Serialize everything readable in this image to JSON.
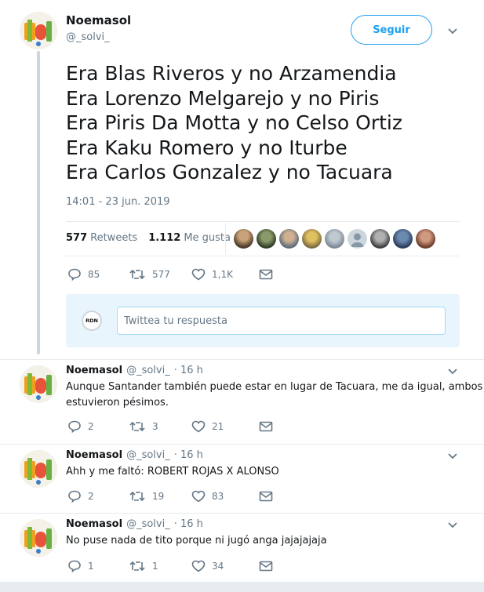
{
  "main_tweet": {
    "author_name": "Noemasol",
    "author_handle": "@_solvi_",
    "follow_label": "Seguir",
    "lines": [
      "Era Blas Riveros y no Arzamendia",
      "Era Lorenzo Melgarejo y no Piris",
      "Era Piris Da Motta y no Celso Ortiz",
      "Era Kaku Romero y no Iturbe",
      "Era Carlos Gonzalez y no Tacuara"
    ],
    "timestamp": "14:01 - 23 jun. 2019",
    "retweets_count": "577",
    "retweets_label": "Retweets",
    "likes_count": "1.112",
    "likes_label": "Me gusta",
    "actions": {
      "replies": "85",
      "retweets": "577",
      "likes": "1,1K"
    }
  },
  "reply_box": {
    "avatar_label": "RDN",
    "placeholder": "Twittea tu respuesta"
  },
  "replies": [
    {
      "author_name": "Noemasol",
      "author_handle": "@_solvi_",
      "time": "· 16 h",
      "text_lines": [
        "Aunque Santander también puede estar en lugar de Tacuara, me da igual, ambos",
        "estuvieron pésimos."
      ],
      "replies": "2",
      "retweets": "3",
      "likes": "21"
    },
    {
      "author_name": "Noemasol",
      "author_handle": "@_solvi_",
      "time": "· 16 h",
      "text_lines": [
        "Ahh y me faltó: ROBERT ROJAS X ALONSO"
      ],
      "replies": "2",
      "retweets": "19",
      "likes": "83"
    },
    {
      "author_name": "Noemasol",
      "author_handle": "@_solvi_",
      "time": "· 16 h",
      "text_lines": [
        "No puse nada de tito porque ni jugó anga jajajajaja"
      ],
      "replies": "1",
      "retweets": "1",
      "likes": "34"
    }
  ],
  "colors": {
    "accent": "#1da1f2",
    "muted": "#657786",
    "text": "#14171a",
    "divider": "#e6ecf0",
    "reply_bg": "#e8f5fd"
  },
  "icons": [
    "reply-icon",
    "retweet-icon",
    "like-icon",
    "dm-icon",
    "chevron-down-icon"
  ]
}
